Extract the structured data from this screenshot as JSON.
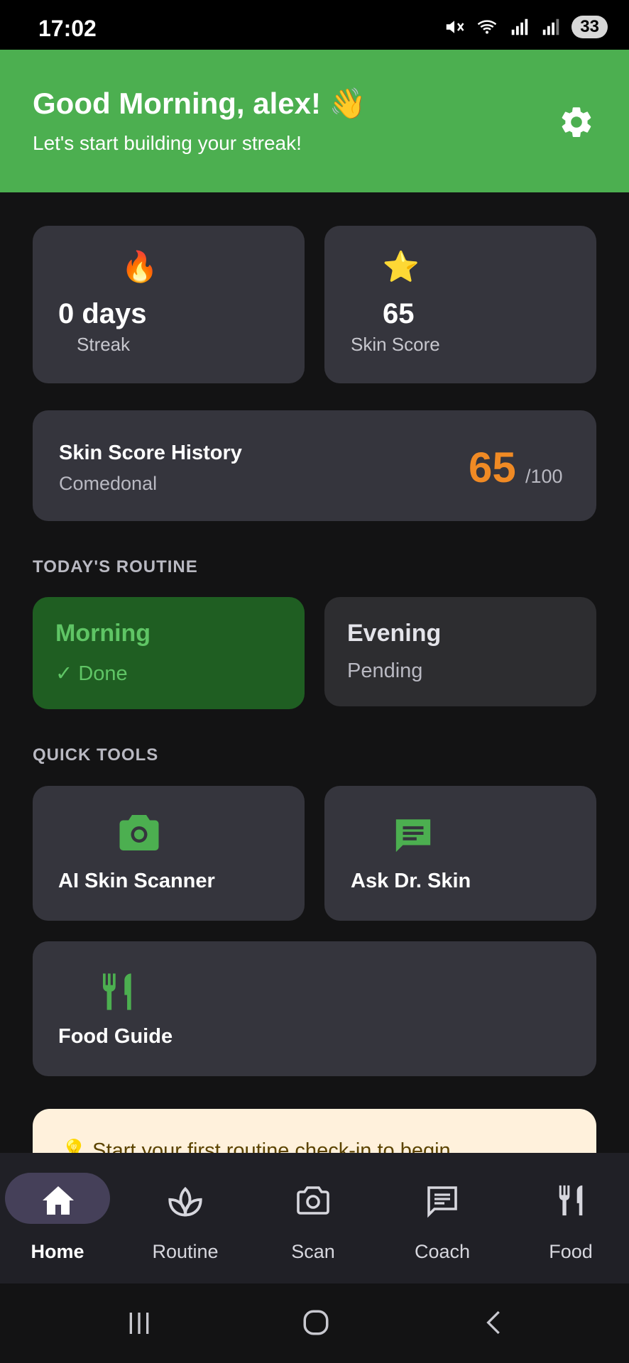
{
  "status_bar": {
    "time": "17:02",
    "battery": "33"
  },
  "header": {
    "greeting": "Good Morning, alex! 👋",
    "subtitle": "Let's start building your streak!"
  },
  "stats": {
    "streak": {
      "emoji": "🔥",
      "value": "0 days",
      "label": "Streak"
    },
    "score": {
      "emoji": "⭐",
      "value": "65",
      "label": "Skin Score"
    }
  },
  "history": {
    "title": "Skin Score History",
    "subtitle": "Comedonal",
    "score": "65",
    "max": "/100",
    "accent": "#f08a24"
  },
  "routine": {
    "section_title": "TODAY'S ROUTINE",
    "morning": {
      "title": "Morning",
      "status": "✓ Done"
    },
    "evening": {
      "title": "Evening",
      "status": "Pending"
    }
  },
  "tools": {
    "section_title": "QUICK TOOLS",
    "scanner": "AI Skin Scanner",
    "ask": "Ask Dr. Skin",
    "food": "Food Guide",
    "icon_color": "#4caf50"
  },
  "tip": {
    "text": "💡 Start your first routine check-in to begin"
  },
  "nav": {
    "home": "Home",
    "routine": "Routine",
    "scan": "Scan",
    "coach": "Coach",
    "food": "Food"
  }
}
